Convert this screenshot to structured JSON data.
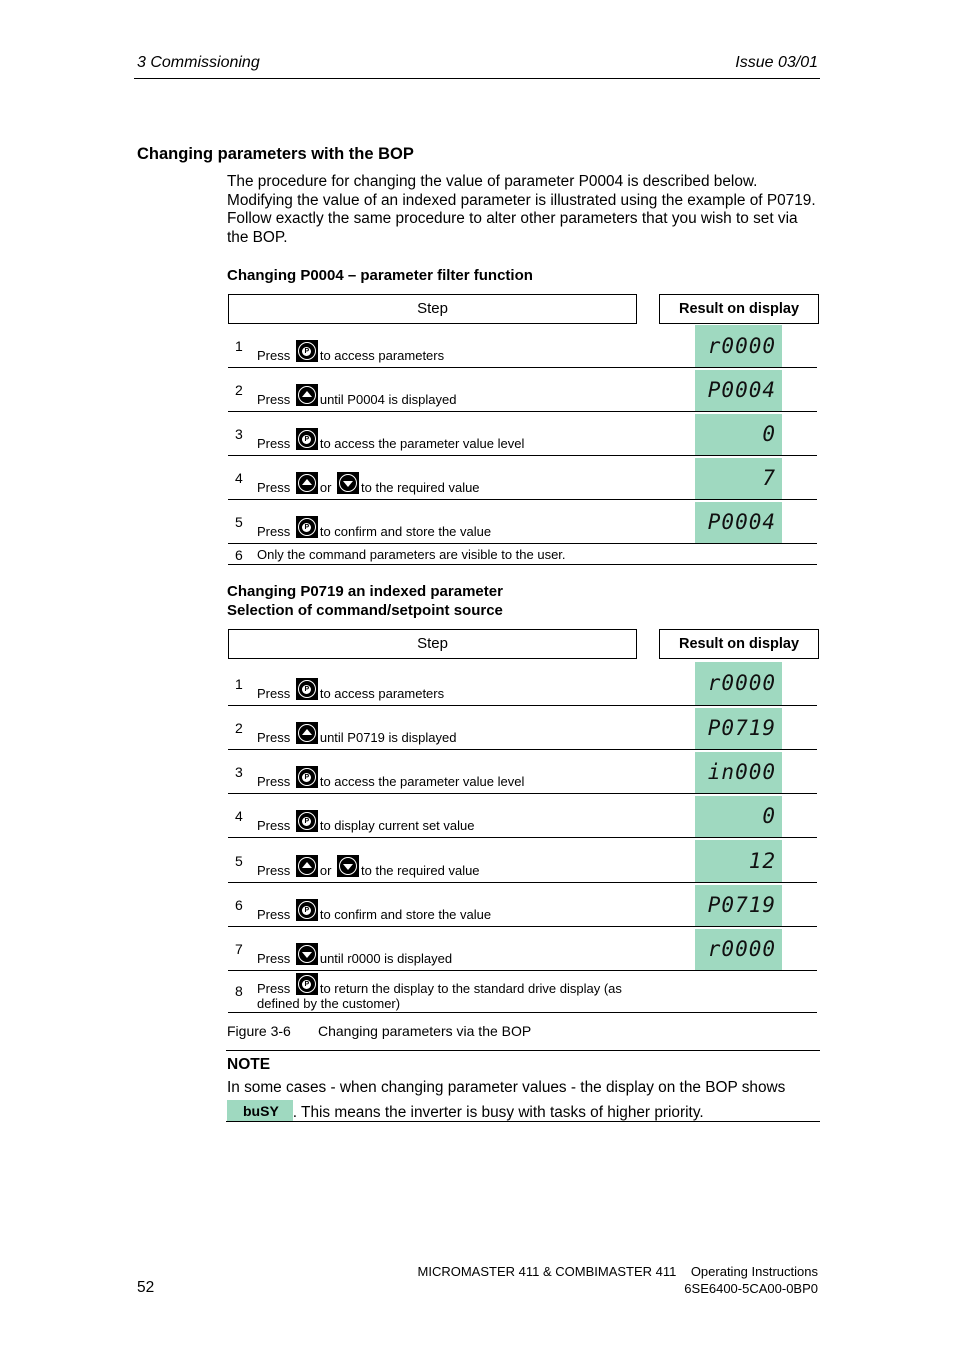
{
  "header": {
    "chapter": "3  Commissioning",
    "issue": "Issue 03/01"
  },
  "section_title": "Changing parameters with the BOP",
  "intro": "The procedure for changing the value of parameter P0004 is described below. Modifying the value of an indexed parameter is illustrated using the example of P0719. Follow exactly the same procedure to alter other parameters that you wish to set via the BOP.",
  "table1": {
    "title": "Changing P0004 – parameter filter function",
    "col_step": "Step",
    "col_result": "Result on display",
    "rows": [
      {
        "num": "1",
        "press": "Press",
        "keys": [
          "p-key-icon"
        ],
        "text": "to access parameters",
        "display": "r0000"
      },
      {
        "num": "2",
        "press": "Press",
        "keys": [
          "up-key-icon"
        ],
        "text": "until P0004 is displayed",
        "display": "P0004"
      },
      {
        "num": "3",
        "press": "Press",
        "keys": [
          "p-key-icon"
        ],
        "text": "to access the parameter value level",
        "display": "0"
      },
      {
        "num": "4",
        "press": "Press",
        "keys": [
          "up-key-icon",
          "down-key-icon"
        ],
        "or": "or",
        "text": "to the required value",
        "display": "7"
      },
      {
        "num": "5",
        "press": "Press",
        "keys": [
          "p-key-icon"
        ],
        "text": "to confirm and store the value",
        "display": "P0004"
      },
      {
        "num": "6",
        "text": "Only the command parameters are visible to the user."
      }
    ]
  },
  "table2": {
    "title_line1": "Changing P0719 an indexed parameter",
    "title_line2": "Selection of command/setpoint source",
    "col_step": "Step",
    "col_result": "Result on display",
    "rows": [
      {
        "num": "1",
        "press": "Press",
        "keys": [
          "p-key-icon"
        ],
        "text": "to access parameters",
        "display": "r0000"
      },
      {
        "num": "2",
        "press": "Press",
        "keys": [
          "up-key-icon"
        ],
        "text": "until P0719 is displayed",
        "display": "P0719"
      },
      {
        "num": "3",
        "press": "Press",
        "keys": [
          "p-key-icon"
        ],
        "text": "to access the parameter value level",
        "display": "in000"
      },
      {
        "num": "4",
        "press": "Press",
        "keys": [
          "p-key-icon"
        ],
        "text": "to display current set value",
        "display": "0"
      },
      {
        "num": "5",
        "press": "Press",
        "keys": [
          "up-key-icon",
          "down-key-icon"
        ],
        "or": "or",
        "text": "to the required value",
        "display": "12"
      },
      {
        "num": "6",
        "press": "Press",
        "keys": [
          "p-key-icon"
        ],
        "text": "to confirm and store the value",
        "display": "P0719"
      },
      {
        "num": "7",
        "press": "Press",
        "keys": [
          "down-key-icon"
        ],
        "text": "until r0000 is displayed",
        "display": "r0000"
      },
      {
        "num": "8",
        "press": "Press",
        "keys": [
          "p-key-icon"
        ],
        "text": "to return the display to the standard drive display (as",
        "text2": "defined by the customer)"
      }
    ]
  },
  "figure_caption": {
    "label": "Figure 3-6",
    "text": "Changing parameters via the BOP"
  },
  "note": {
    "title": "NOTE",
    "text_before": "In some cases - when changing parameter values - the display on the BOP shows",
    "badge": "buSY",
    "text_after": ". This means the inverter is busy with tasks of higher priority.",
    "badge_color": "#9fd9c0"
  },
  "footer": {
    "page_number": "52",
    "product": "MICROMASTER 411 & COMBIMASTER 411    Operating Instructions",
    "order_number": "6SE6400-5CA00-0BP0"
  }
}
